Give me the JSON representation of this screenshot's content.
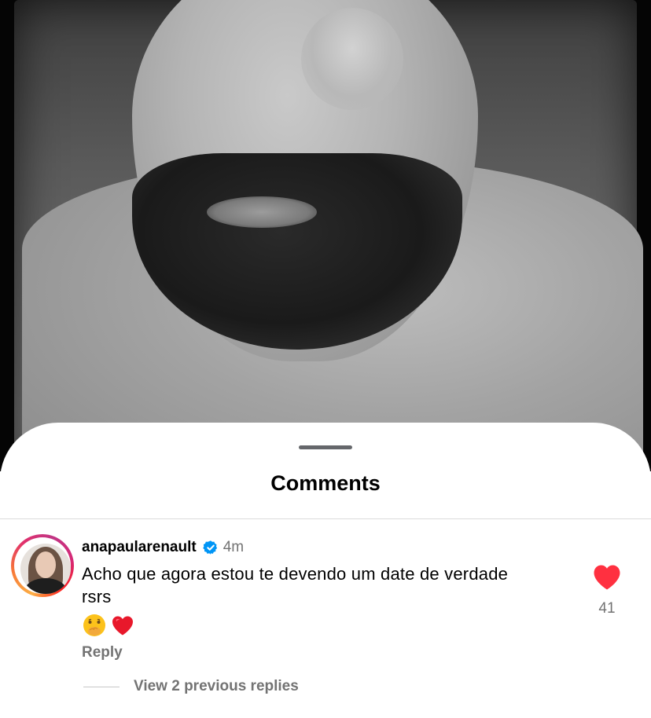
{
  "sheet": {
    "title": "Comments"
  },
  "comment": {
    "username": "anapaularenault",
    "verified": true,
    "time": "4m",
    "text": "Acho que agora estou te devendo um date de verdade rsrs",
    "reactions": [
      "face-with-hand-over-mouth-emoji",
      "red-heart-emoji"
    ],
    "reply_label": "Reply",
    "like_count": "41",
    "liked": true,
    "view_replies_label": "View 2 previous replies"
  },
  "colors": {
    "like_red": "#ff3040",
    "verified_blue": "#0095f6",
    "secondary_text": "#737373"
  }
}
